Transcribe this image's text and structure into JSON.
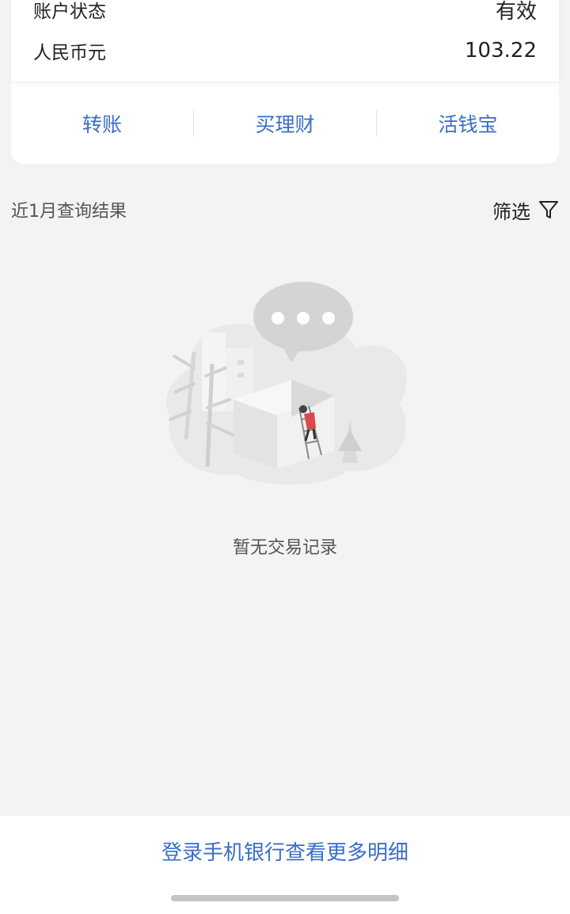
{
  "account": {
    "status_label": "账户状态",
    "status_value": "有效",
    "currency_label": "人民币元",
    "balance": "103.22"
  },
  "actions": [
    {
      "label": "转账"
    },
    {
      "label": "买理财"
    },
    {
      "label": "活钱宝"
    }
  ],
  "query": {
    "title": "近1月查询结果",
    "filter_label": "筛选",
    "filter_icon": "filter-icon"
  },
  "empty_state": {
    "illustration": "empty-records-illustration",
    "message": "暂无交易记录"
  },
  "bottom": {
    "login_link": "登录手机银行查看更多明细"
  },
  "colors": {
    "accent": "#3a6ec8",
    "background": "#f3f3f3",
    "card": "#ffffff"
  }
}
